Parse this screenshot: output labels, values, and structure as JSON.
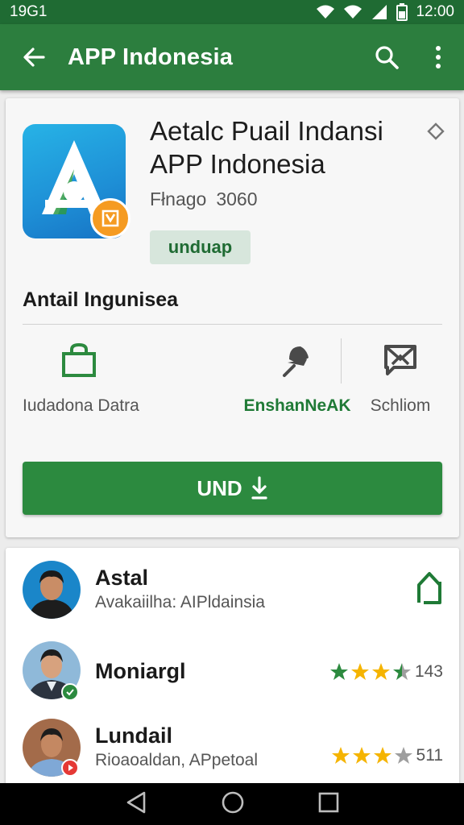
{
  "status": {
    "time_left": "19G1",
    "time_right": "12:00"
  },
  "appbar": {
    "title": "APP Indonesia"
  },
  "app": {
    "name_line1": "Aetalc Puail Indansi",
    "name_line2": "APP Indonesia",
    "meta_label": "Fłnago",
    "meta_value": "3060",
    "tag": "unduap",
    "section_title": "Antail Ingunisea",
    "features": [
      {
        "label": "Iudadona Datra",
        "icon": "bag-icon"
      },
      {
        "label": "EnshanNeAK",
        "icon": "pin-icon"
      },
      {
        "label": "Schliom",
        "icon": "message-icon"
      }
    ],
    "install_label": "UND"
  },
  "reviews": [
    {
      "name": "Astal",
      "subtitle": "Avakaiilha: AIPldainsia",
      "icon": "home-outline-icon"
    },
    {
      "name": "Moniargl",
      "rating": 3.5,
      "count": "143"
    },
    {
      "name": "Lundail",
      "subtitle": "Rioaoaldan, APpetoal",
      "rating": 3,
      "count": "511"
    }
  ],
  "colors": {
    "primary": "#2c7e3e",
    "primary_dark": "#1f6b33",
    "star_filled": "#f5b400",
    "star_green": "#2c8a3f"
  }
}
